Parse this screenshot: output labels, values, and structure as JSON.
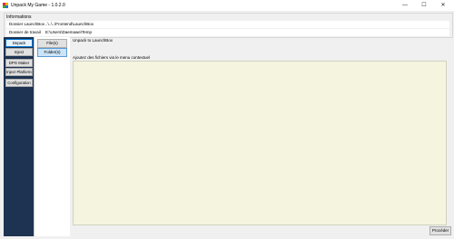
{
  "window": {
    "title": "Unpack My Game - 1.0.2.0",
    "controls": {
      "minimize": "—",
      "maximize": "☐",
      "close": "✕"
    },
    "icon_colors": [
      "#e03030",
      "#f0b400",
      "#3aa63a",
      "#2a6fd6"
    ]
  },
  "info": {
    "title": "Informations",
    "rows": [
      {
        "label": "Dossier LaunchBox",
        "value": "..\\..\\..\\Frontend\\LaunchBox"
      },
      {
        "label": "Dossier de travail",
        "value": "E:\\Users\\Daemawe\\Temp"
      }
    ]
  },
  "sidebar": {
    "items": [
      {
        "label": "Depack",
        "active": true
      },
      {
        "label": "Inject",
        "active": false
      },
      {
        "label": "DPG Maker",
        "active": false
      },
      {
        "label": "Inject Platforms",
        "active": false
      },
      {
        "label": "Configuration",
        "active": false
      }
    ]
  },
  "subtabs": {
    "items": [
      {
        "label": "File(s)",
        "active": false
      },
      {
        "label": "Folder(s)",
        "active": true
      }
    ]
  },
  "content": {
    "header": "Unpack to LaunchBox",
    "hint": "Ajoutez des fichiers via le menu contextuel"
  },
  "actions": {
    "process_label": "Procéder"
  }
}
